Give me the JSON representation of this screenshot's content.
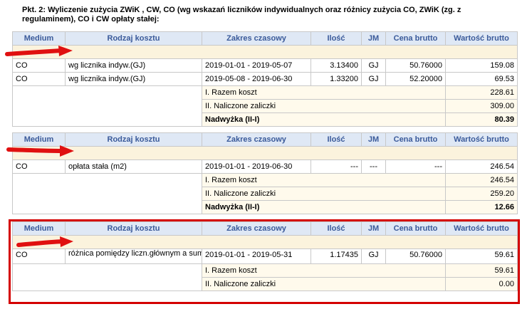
{
  "title": "Pkt. 2: Wyliczenie zużycia ZWiK , CW, CO (wg wskazań liczników indywidualnych oraz różnicy zużycia CO, ZWiK (zg. z regulaminem), CO i CW opłaty stałej:",
  "headers": {
    "medium": "Medium",
    "rodzaj": "Rodzaj kosztu",
    "zakres": "Zakres czasowy",
    "ilosc": "Ilość",
    "jm": "JM",
    "cena": "Cena brutto",
    "wartosc": "Wartość brutto"
  },
  "table1": {
    "rows": [
      {
        "medium": "CO",
        "rodzaj": "wg licznika indyw.(GJ)",
        "zakres": "2019-01-01 - 2019-05-07",
        "ilosc": "3.13400",
        "jm": "GJ",
        "cena": "50.76000",
        "wartosc": "159.08"
      },
      {
        "medium": "CO",
        "rodzaj": "wg licznika indyw.(GJ)",
        "zakres": "2019-05-08 - 2019-06-30",
        "ilosc": "1.33200",
        "jm": "GJ",
        "cena": "52.20000",
        "wartosc": "69.53"
      }
    ],
    "summary": [
      {
        "label": "I. Razem koszt",
        "value": "228.61"
      },
      {
        "label": "II. Naliczone zaliczki",
        "value": "309.00"
      },
      {
        "label": "Nadwyżka (II-I)",
        "value": "80.39"
      }
    ]
  },
  "table2": {
    "rows": [
      {
        "medium": "CO",
        "rodzaj": "opłata stała (m2)",
        "zakres": "2019-01-01 - 2019-06-30",
        "ilosc": "---",
        "jm": "---",
        "cena": "---",
        "wartosc": "246.54"
      }
    ],
    "summary": [
      {
        "label": "I. Razem koszt",
        "value": "246.54"
      },
      {
        "label": "II. Naliczone zaliczki",
        "value": "259.20"
      },
      {
        "label": "Nadwyżka (II-I)",
        "value": "12.66"
      }
    ]
  },
  "table3": {
    "rows": [
      {
        "medium": "CO",
        "rodzaj": "różnica pomiędzy liczn.głównym a sumą liczn.ind.(wg powierzchni)",
        "zakres": "2019-01-01 - 2019-05-31",
        "ilosc": "1.17435",
        "jm": "GJ",
        "cena": "50.76000",
        "wartosc": "59.61"
      }
    ],
    "summary": [
      {
        "label": "I. Razem koszt",
        "value": "59.61"
      },
      {
        "label": "II. Naliczone zaliczki",
        "value": "0.00"
      }
    ]
  },
  "annotation_colors": {
    "arrow": "#e01010",
    "highlight_box": "#d40000"
  }
}
